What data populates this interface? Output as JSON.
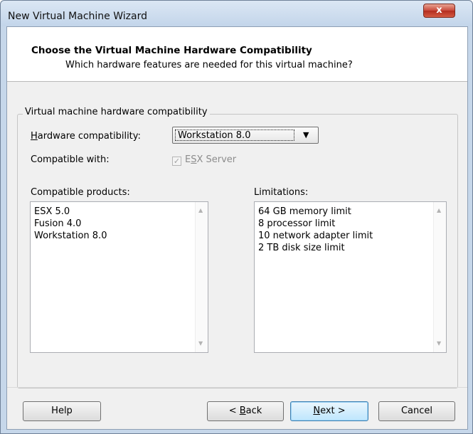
{
  "window": {
    "title": "New Virtual Machine Wizard",
    "close_glyph": "x"
  },
  "header": {
    "title": "Choose the Virtual Machine Hardware Compatibility",
    "subtitle": "Which hardware features are needed for this virtual machine?"
  },
  "group": {
    "legend": "Virtual machine hardware compatibility",
    "hardware_label_prefix": "",
    "hardware_label_mnemonic": "H",
    "hardware_label_rest": "ardware compatibility:",
    "hardware_value": "Workstation 8.0",
    "dropdown_glyph": "▼",
    "compatible_with_label": "Compatible with:",
    "esx_checked_glyph": "✓",
    "esx_label_pre": "E",
    "esx_label_mnemonic": "S",
    "esx_label_rest": "X Server",
    "esx_checked": true,
    "esx_disabled": true
  },
  "compatible_products": {
    "label": "Compatible products:",
    "items": [
      "ESX 5.0",
      "Fusion 4.0",
      "Workstation 8.0"
    ]
  },
  "limitations": {
    "label": "Limitations:",
    "items": [
      "64 GB memory limit",
      "8 processor limit",
      "10 network adapter limit",
      "2 TB disk size limit"
    ]
  },
  "scroll": {
    "up_glyph": "▲",
    "down_glyph": "▼"
  },
  "buttons": {
    "help": "Help",
    "back_pre": "< ",
    "back_mnemonic": "B",
    "back_rest": "ack",
    "next_mnemonic": "N",
    "next_rest": "ext >",
    "cancel": "Cancel"
  },
  "colors": {
    "client_bg": "#f0f0f0",
    "frame": "#c6d7ea",
    "close_button": "#c8483a",
    "default_button_border": "#3c7fb1"
  }
}
